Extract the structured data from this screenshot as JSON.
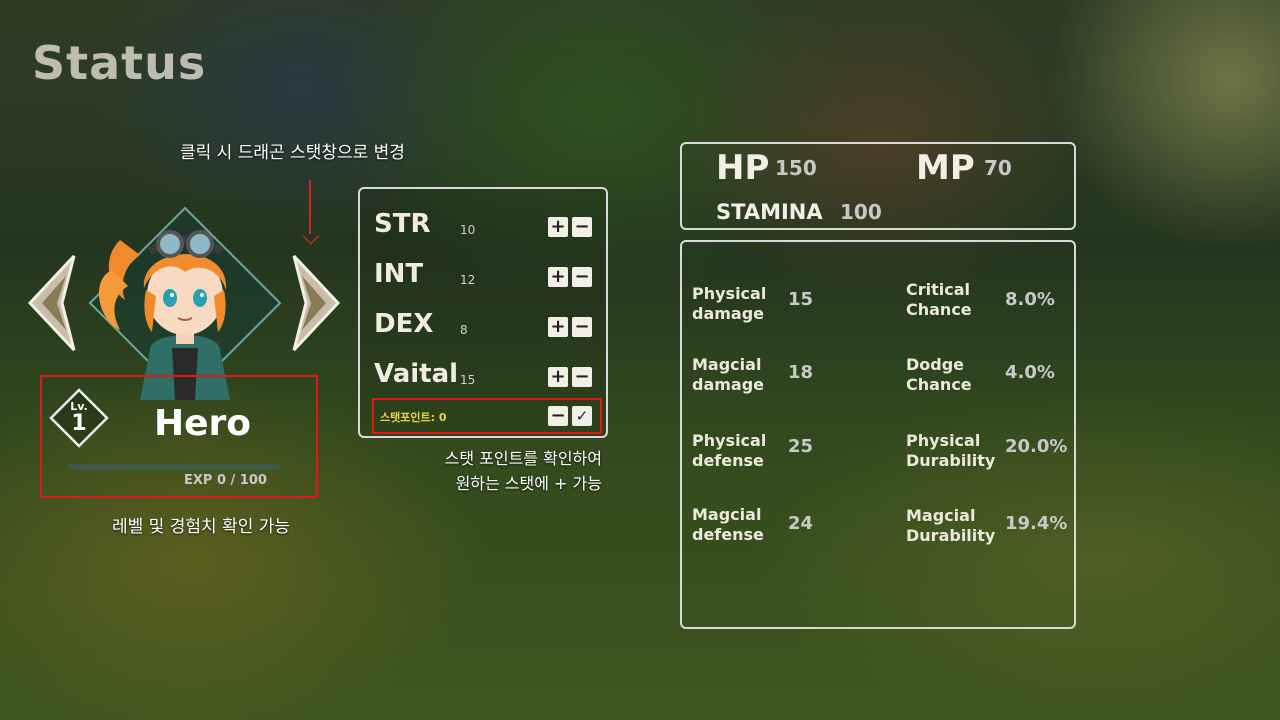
{
  "screen": {
    "title": "Status"
  },
  "annotations": {
    "dragon": "클릭 시 드래곤 스탯창으로 변경",
    "points_line1": "스탯 포인트를 확인하여",
    "points_line2": "원하는 스탯에 + 가능",
    "level": "레벨 및 경험치 확인 가능"
  },
  "hero": {
    "lv_label": "Lv.",
    "level": "1",
    "name": "Hero",
    "exp_text": "EXP 0 / 100",
    "exp_fraction": 0
  },
  "stats": [
    {
      "name": "STR",
      "value": "10"
    },
    {
      "name": "INT",
      "value": "12"
    },
    {
      "name": "DEX",
      "value": "8"
    },
    {
      "name": "Vaital",
      "value": "15"
    }
  ],
  "stat_points": {
    "label": "스탯포인트: 0"
  },
  "buttons": {
    "plus": "+",
    "minus": "−",
    "confirm": "✓"
  },
  "vitals": {
    "hp_label": "HP",
    "hp_value": "150",
    "mp_label": "MP",
    "mp_value": "70",
    "stamina_label": "STAMINA",
    "stamina_value": "100"
  },
  "details": [
    {
      "line1": "Physical",
      "line2": "damage",
      "value": "15"
    },
    {
      "line1": "Critical",
      "line2": "Chance",
      "value": "8.0%"
    },
    {
      "line1": "Magcial",
      "line2": "damage",
      "value": "18"
    },
    {
      "line1": "Dodge",
      "line2": "Chance",
      "value": "4.0%"
    },
    {
      "line1": "Physical",
      "line2": "defense",
      "value": "25"
    },
    {
      "line1": "Physical",
      "line2": "Durability",
      "value": "20.0%"
    },
    {
      "line1": "Magcial",
      "line2": "defense",
      "value": "24"
    },
    {
      "line1": "Magcial",
      "line2": "Durability",
      "value": "19.4%"
    }
  ],
  "colors": {
    "highlight_border": "#e01818",
    "points_text": "#e8d24a",
    "arrow": "#e02020"
  }
}
